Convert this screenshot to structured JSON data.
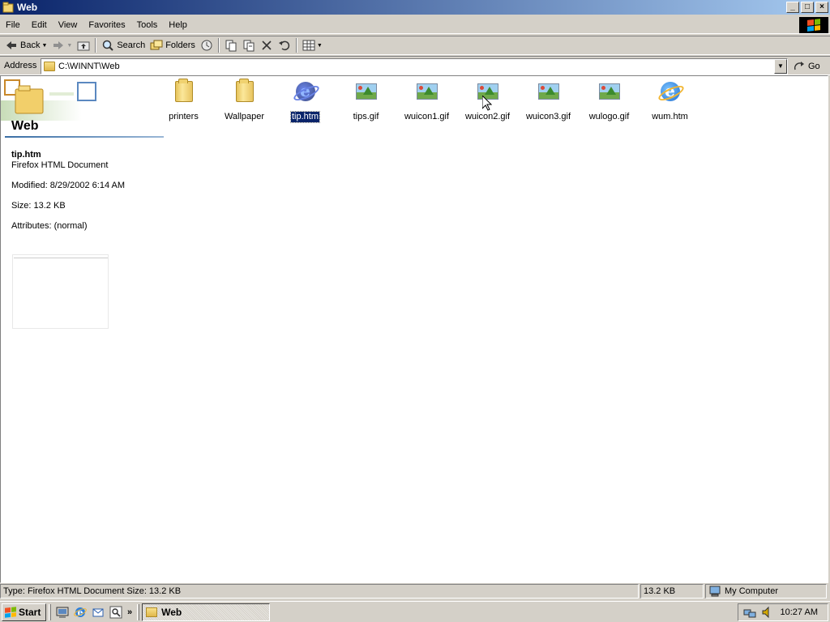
{
  "window": {
    "title": "Web",
    "buttons": {
      "minimize": "_",
      "maximize": "□",
      "close": "×"
    }
  },
  "menu": [
    "File",
    "Edit",
    "View",
    "Favorites",
    "Tools",
    "Help"
  ],
  "toolbar": {
    "back": "Back",
    "search": "Search",
    "folders": "Folders"
  },
  "address": {
    "label": "Address",
    "value": "C:\\WINNT\\Web",
    "go": "Go"
  },
  "webview": {
    "folder_title": "Web",
    "selected": {
      "name": "tip.htm",
      "type": "Firefox HTML Document",
      "modified": "Modified: 8/29/2002 6:14 AM",
      "size": "Size: 13.2 KB",
      "attributes": "Attributes: (normal)"
    }
  },
  "files": [
    {
      "name": "printers",
      "icon": "folder-icon",
      "selected": false
    },
    {
      "name": "Wallpaper",
      "icon": "folder-icon",
      "selected": false
    },
    {
      "name": "tip.htm",
      "icon": "ie-document-icon",
      "selected": true
    },
    {
      "name": "tips.gif",
      "icon": "gif-image-icon",
      "selected": false
    },
    {
      "name": "wuicon1.gif",
      "icon": "gif-image-icon",
      "selected": false
    },
    {
      "name": "wuicon2.gif",
      "icon": "gif-image-icon",
      "selected": false
    },
    {
      "name": "wuicon3.gif",
      "icon": "gif-image-icon",
      "selected": false
    },
    {
      "name": "wulogo.gif",
      "icon": "gif-image-icon",
      "selected": false
    },
    {
      "name": "wum.htm",
      "icon": "ie-document-icon",
      "selected": false
    }
  ],
  "status": {
    "type_size": "Type: Firefox HTML Document Size: 13.2 KB",
    "size": "13.2 KB",
    "zone": "My Computer"
  },
  "taskbar": {
    "start": "Start",
    "task": "Web",
    "clock": "10:27 AM",
    "more": "»"
  },
  "colors": {
    "title_active": "#0a246a",
    "selection": "#0a246a",
    "face": "#d4d0c8"
  }
}
